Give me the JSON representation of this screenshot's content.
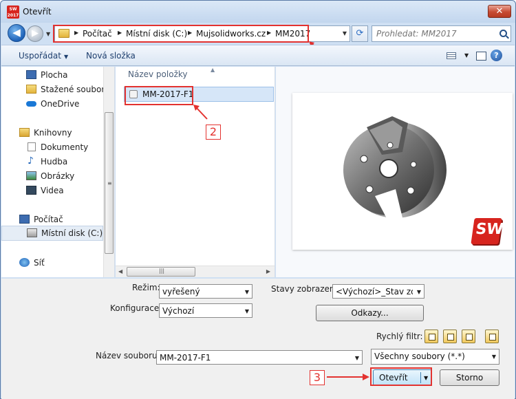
{
  "window": {
    "title": "Otevřít",
    "app_icon_text": "SW 2017",
    "close": "✕"
  },
  "nav": {
    "breadcrumbs": [
      "Počítač",
      "Místní disk (C:)",
      "Mujsolidworks.cz",
      "MM2017"
    ],
    "search_placeholder": "Prohledat: MM2017"
  },
  "toolbar": {
    "organize": "Uspořádat",
    "new_folder": "Nová složka"
  },
  "sidebar": {
    "items": [
      {
        "label": "Plocha"
      },
      {
        "label": "Stažené soubory"
      },
      {
        "label": "OneDrive"
      },
      {
        "label": "Knihovny"
      },
      {
        "label": "Dokumenty"
      },
      {
        "label": "Hudba"
      },
      {
        "label": "Obrázky"
      },
      {
        "label": "Videa"
      },
      {
        "label": "Počítač"
      },
      {
        "label": "Místní disk (C:)"
      },
      {
        "label": "Síť"
      }
    ]
  },
  "files": {
    "column_header": "Název položky",
    "rows": [
      {
        "name": "MM-2017-F1"
      }
    ]
  },
  "preview": {
    "watermark": "SW"
  },
  "options": {
    "mode_label": "Režim:",
    "mode_value": "vyřešený",
    "config_label": "Konfigurace:",
    "config_value": "Výchozí",
    "display_states_label": "Stavy zobrazení:",
    "display_states_value": "<Výchozí>_Stav zobr",
    "references_button": "Odkazy...",
    "quick_filter_label": "Rychlý filtr:"
  },
  "filename": {
    "label": "Název souboru:",
    "value": "MM-2017-F1",
    "filetype": "Všechny soubory (*.*)"
  },
  "actions": {
    "open": "Otevřít",
    "cancel": "Storno"
  },
  "annotations": {
    "one": "1",
    "two": "2",
    "three": "3"
  },
  "colors": {
    "annotation": "#e3322f",
    "accent": "#1e62b8"
  }
}
